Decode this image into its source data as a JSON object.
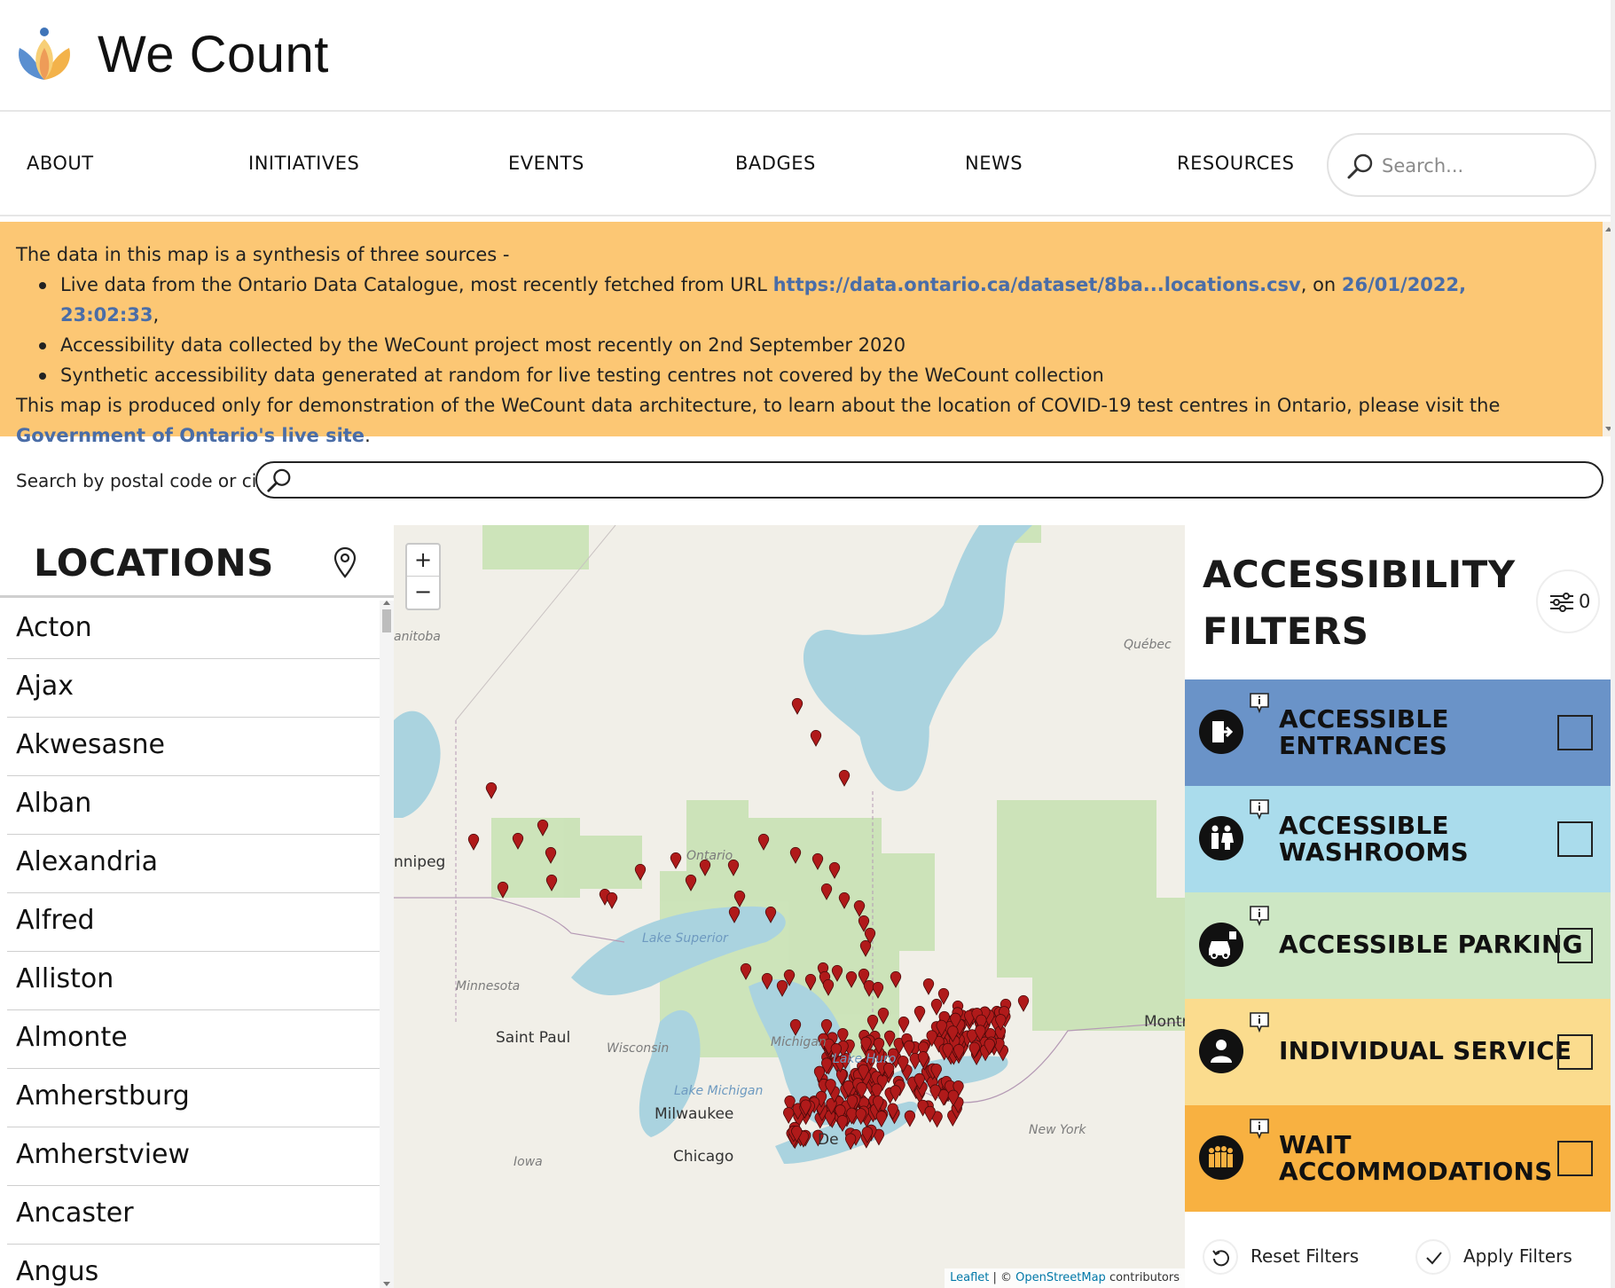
{
  "header": {
    "site_title": "We Count",
    "logo_icon": "lotus-logo-icon"
  },
  "nav": {
    "items": [
      {
        "label": "ABOUT"
      },
      {
        "label": "INITIATIVES"
      },
      {
        "label": "EVENTS"
      },
      {
        "label": "BADGES"
      },
      {
        "label": "NEWS"
      },
      {
        "label": "RESOURCES"
      }
    ],
    "search_placeholder": "Search..."
  },
  "notice": {
    "intro": "The data in this map is a synthesis of three sources -",
    "bullet1_prefix": "Live data from the Ontario Data Catalogue, most recently fetched from URL ",
    "bullet1_link": "https://data.ontario.ca/dataset/8ba...locations.csv",
    "bullet1_mid": ", on ",
    "bullet1_date": "26/01/2022, 23:02:33",
    "bullet1_suffix": ",",
    "bullet2": "Accessibility data collected by the WeCount project most recently on 2nd September 2020",
    "bullet3": "Synthetic accessibility data generated at random for live testing centres not covered by the WeCount collection",
    "outro_prefix": "This map is produced only for demonstration of the WeCount data architecture, to learn about the location of COVID-19 test centres in Ontario, please visit the ",
    "outro_link": "Government of Ontario's live site",
    "outro_suffix": "."
  },
  "location_search": {
    "label": "Search by postal code or city",
    "value": ""
  },
  "locations": {
    "title": "LOCATIONS",
    "items": [
      "Acton",
      "Ajax",
      "Akwesasne",
      "Alban",
      "Alexandria",
      "Alfred",
      "Alliston",
      "Almonte",
      "Amherstburg",
      "Amherstview",
      "Ancaster",
      "Angus"
    ]
  },
  "map": {
    "zoom_in": "+",
    "zoom_out": "−",
    "labels": {
      "manitoba": "anitoba",
      "winnipeg": "nnipeg",
      "ontario": "Ontario",
      "quebec": "Québec",
      "lake_superior": "Lake Superior",
      "minnesota": "Minnesota",
      "saint_paul": "Saint Paul",
      "wisconsin": "Wisconsin",
      "michigan": "Michigan",
      "lake_huron": "Lake Huro",
      "lake_michigan": "Lake Michigan",
      "milwaukee": "Milwaukee",
      "chicago": "Chicago",
      "iowa": "Iowa",
      "detroit": "De",
      "new_york": "New York",
      "montreal": "Montr"
    },
    "attribution_leaflet": "Leaflet",
    "attribution_sep": " | © ",
    "attribution_osm": "OpenStreetMap",
    "attribution_suffix": " contributors",
    "marker_color": "#b01a1a"
  },
  "filters": {
    "title_line1": "ACCESSIBILITY",
    "title_line2": "FILTERS",
    "count": "0",
    "items": [
      {
        "line1": "ACCESSIBLE",
        "line2": "ENTRANCES",
        "color": "#6a93c8",
        "icon": "entrance-icon"
      },
      {
        "line1": "ACCESSIBLE",
        "line2": "WASHROOMS",
        "color": "#aadcec",
        "icon": "washroom-icon"
      },
      {
        "line1": "ACCESSIBLE PARKING",
        "line2": "",
        "color": "#cde7c4",
        "icon": "parking-icon"
      },
      {
        "line1": "INDIVIDUAL SERVICE",
        "line2": "",
        "color": "#fbdc8e",
        "icon": "person-icon"
      },
      {
        "line1": "WAIT",
        "line2": "ACCOMMODATIONS",
        "color": "#f8b141",
        "icon": "queue-icon"
      }
    ],
    "reset_label": "Reset Filters",
    "apply_label": "Apply Filters"
  }
}
